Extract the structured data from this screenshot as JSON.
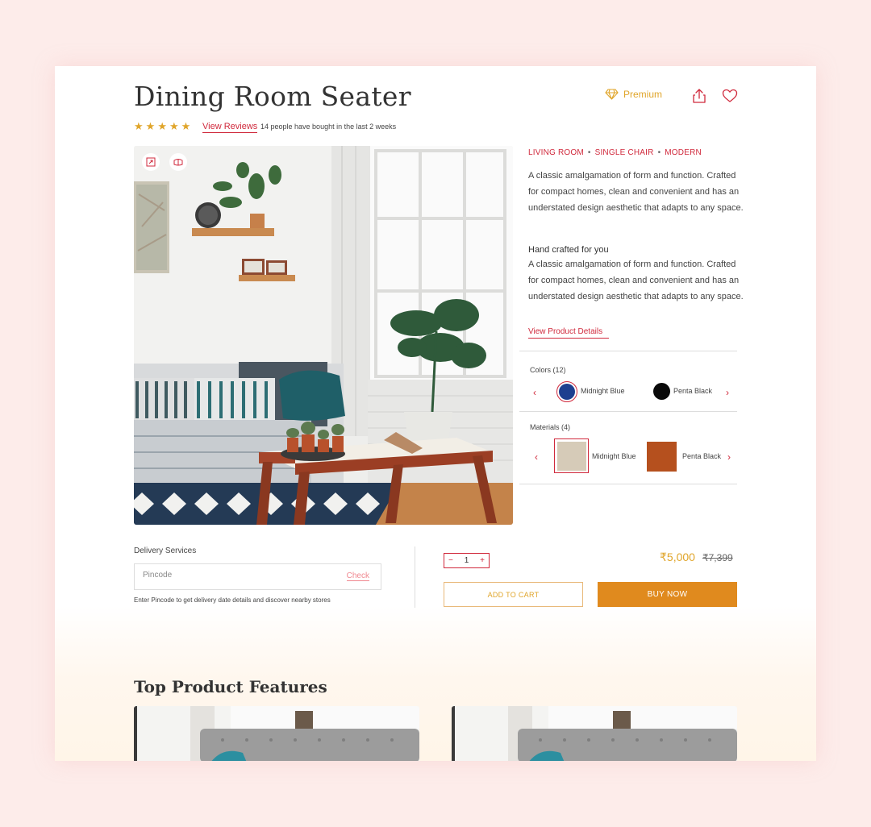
{
  "product": {
    "title": "Dining Room Seater",
    "premium_label": "Premium",
    "rating_stars": 5,
    "view_reviews": "View Reviews",
    "bought_text": "14 people have bought in the last 2 weeks"
  },
  "tags": [
    "LIVING ROOM",
    "SINGLE CHAIR",
    "MODERN"
  ],
  "description": {
    "intro": "A classic amalgamation of form and function. Crafted for compact homes, clean and convenient and has an understated design aesthetic that adapts to any space.",
    "heading": "Hand crafted for you",
    "body": "A classic amalgamation of form and function. Crafted for compact homes, clean and convenient and has an understated design aesthetic that adapts to any space.",
    "details_link": "View Product Details"
  },
  "colors": {
    "label": "Colors (12)",
    "options": [
      {
        "name": "Midnight Blue",
        "hex": "#1e3f8f",
        "selected": true
      },
      {
        "name": "Penta Black",
        "hex": "#0a0a0a",
        "selected": false
      }
    ]
  },
  "materials": {
    "label": "Materials (4)",
    "options": [
      {
        "name": "Midnight Blue",
        "swatch": "#d6cbb8",
        "selected": true
      },
      {
        "name": "Penta Black",
        "swatch": "#b5501e",
        "selected": false
      }
    ]
  },
  "delivery": {
    "label": "Delivery Services",
    "placeholder": "Pincode",
    "check": "Check",
    "help": "Enter Pincode to get delivery date details and discover nearby stores"
  },
  "purchase": {
    "quantity": "1",
    "minus": "−",
    "plus": "+",
    "price": "₹5,000",
    "old_price": "₹7,399",
    "add_to_cart": "ADD TO CART",
    "buy_now": "BUY NOW"
  },
  "features": {
    "title": "Top Product Features"
  },
  "colors_theme": {
    "accent_red": "#d0293c",
    "accent_gold": "#e0a52a",
    "buy_orange": "#e08a1e",
    "background": "#fdecea"
  },
  "icons": [
    "diamond-icon",
    "share-icon",
    "heart-icon",
    "star-icon",
    "expand-icon",
    "view-360-icon",
    "chevron-left-icon",
    "chevron-right-icon"
  ]
}
